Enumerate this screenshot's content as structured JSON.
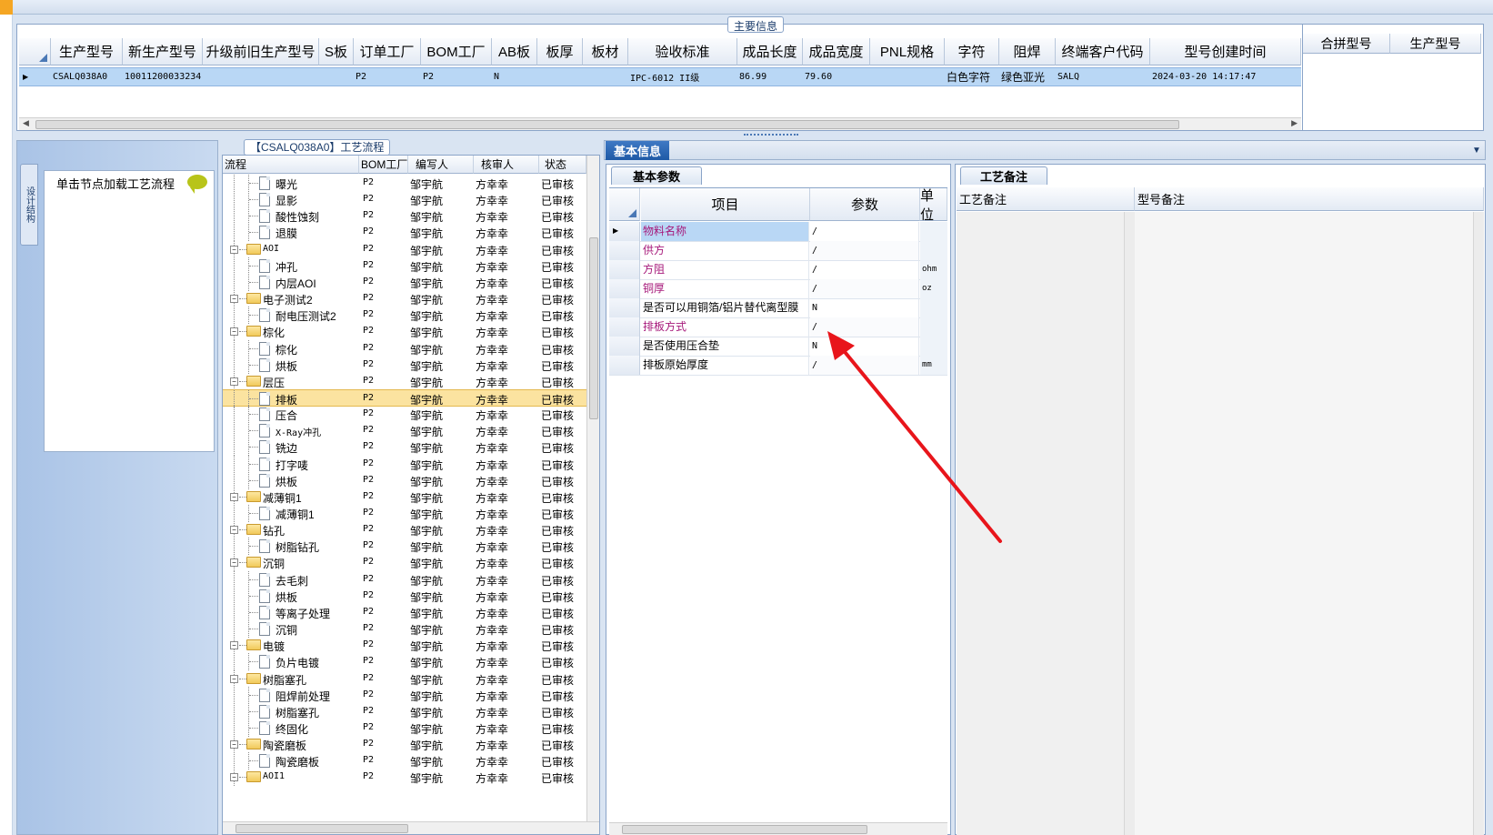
{
  "main_info": {
    "title": "主要信息",
    "columns": [
      "生产型号",
      "新生产型号",
      "升级前旧生产型号",
      "S板",
      "订单工厂",
      "BOM工厂",
      "AB板",
      "板厚",
      "板材",
      "验收标准",
      "成品长度",
      "成品宽度",
      "PNL规格",
      "字符",
      "阻焊",
      "终端客户代码",
      "型号创建时间"
    ],
    "row": {
      "model": "CSALQ038A0",
      "new_model": "10011200033234",
      "old_model": "",
      "s_board": "",
      "order_factory": "P2",
      "bom_factory": "P2",
      "ab_board": "N",
      "thickness": "",
      "material": "",
      "standard": "IPC-6012 II级",
      "length": "86.99",
      "width": "79.60",
      "pnl": "",
      "character": "白色字符",
      "solder_mask": "绿色亚光",
      "customer_code": "SALQ",
      "created": "2024-03-20 14:17:47"
    },
    "merge_columns": [
      "合拼型号",
      "生产型号"
    ]
  },
  "left_nav": {
    "vertical_tab": "设计结构",
    "hint": "单击节点加载工艺流程"
  },
  "process": {
    "title": "【CSALQ038A0】工艺流程",
    "columns": [
      "流程",
      "BOM工厂",
      "编写人",
      "核审人",
      "状态"
    ],
    "rows": [
      {
        "name": "曝光",
        "level": 2,
        "bom": "P2",
        "writer": "邹宇航",
        "reviewer": "方幸幸",
        "status": "已审核"
      },
      {
        "name": "显影",
        "level": 2,
        "bom": "P2",
        "writer": "邹宇航",
        "reviewer": "方幸幸",
        "status": "已审核"
      },
      {
        "name": "酸性蚀刻",
        "level": 2,
        "bom": "P2",
        "writer": "邹宇航",
        "reviewer": "方幸幸",
        "status": "已审核"
      },
      {
        "name": "退膜",
        "level": 2,
        "bom": "P2",
        "writer": "邹宇航",
        "reviewer": "方幸幸",
        "status": "已审核"
      },
      {
        "name": "AOI",
        "level": 1,
        "bom": "P2",
        "writer": "邹宇航",
        "reviewer": "方幸幸",
        "status": "已审核"
      },
      {
        "name": "冲孔",
        "level": 2,
        "bom": "P2",
        "writer": "邹宇航",
        "reviewer": "方幸幸",
        "status": "已审核"
      },
      {
        "name": "内层AOI",
        "level": 2,
        "bom": "P2",
        "writer": "邹宇航",
        "reviewer": "方幸幸",
        "status": "已审核"
      },
      {
        "name": "电子测试2",
        "level": 1,
        "bom": "P2",
        "writer": "邹宇航",
        "reviewer": "方幸幸",
        "status": "已审核"
      },
      {
        "name": "耐电压测试2",
        "level": 2,
        "bom": "P2",
        "writer": "邹宇航",
        "reviewer": "方幸幸",
        "status": "已审核"
      },
      {
        "name": "棕化",
        "level": 1,
        "bom": "P2",
        "writer": "邹宇航",
        "reviewer": "方幸幸",
        "status": "已审核"
      },
      {
        "name": "棕化",
        "level": 2,
        "bom": "P2",
        "writer": "邹宇航",
        "reviewer": "方幸幸",
        "status": "已审核"
      },
      {
        "name": "烘板",
        "level": 2,
        "bom": "P2",
        "writer": "邹宇航",
        "reviewer": "方幸幸",
        "status": "已审核"
      },
      {
        "name": "层压",
        "level": 1,
        "bom": "P2",
        "writer": "邹宇航",
        "reviewer": "方幸幸",
        "status": "已审核"
      },
      {
        "name": "排板",
        "level": 2,
        "bom": "P2",
        "writer": "邹宇航",
        "reviewer": "方幸幸",
        "status": "已审核",
        "selected": true
      },
      {
        "name": "压合",
        "level": 2,
        "bom": "P2",
        "writer": "邹宇航",
        "reviewer": "方幸幸",
        "status": "已审核"
      },
      {
        "name": "X-Ray冲孔",
        "level": 2,
        "bom": "P2",
        "writer": "邹宇航",
        "reviewer": "方幸幸",
        "status": "已审核"
      },
      {
        "name": "铣边",
        "level": 2,
        "bom": "P2",
        "writer": "邹宇航",
        "reviewer": "方幸幸",
        "status": "已审核"
      },
      {
        "name": "打字唛",
        "level": 2,
        "bom": "P2",
        "writer": "邹宇航",
        "reviewer": "方幸幸",
        "status": "已审核"
      },
      {
        "name": "烘板",
        "level": 2,
        "bom": "P2",
        "writer": "邹宇航",
        "reviewer": "方幸幸",
        "status": "已审核"
      },
      {
        "name": "减薄铜1",
        "level": 1,
        "bom": "P2",
        "writer": "邹宇航",
        "reviewer": "方幸幸",
        "status": "已审核"
      },
      {
        "name": "减薄铜1",
        "level": 2,
        "bom": "P2",
        "writer": "邹宇航",
        "reviewer": "方幸幸",
        "status": "已审核"
      },
      {
        "name": "钻孔",
        "level": 1,
        "bom": "P2",
        "writer": "邹宇航",
        "reviewer": "方幸幸",
        "status": "已审核"
      },
      {
        "name": "树脂钻孔",
        "level": 2,
        "bom": "P2",
        "writer": "邹宇航",
        "reviewer": "方幸幸",
        "status": "已审核"
      },
      {
        "name": "沉铜",
        "level": 1,
        "bom": "P2",
        "writer": "邹宇航",
        "reviewer": "方幸幸",
        "status": "已审核"
      },
      {
        "name": "去毛刺",
        "level": 2,
        "bom": "P2",
        "writer": "邹宇航",
        "reviewer": "方幸幸",
        "status": "已审核"
      },
      {
        "name": "烘板",
        "level": 2,
        "bom": "P2",
        "writer": "邹宇航",
        "reviewer": "方幸幸",
        "status": "已审核"
      },
      {
        "name": "等离子处理",
        "level": 2,
        "bom": "P2",
        "writer": "邹宇航",
        "reviewer": "方幸幸",
        "status": "已审核"
      },
      {
        "name": "沉铜",
        "level": 2,
        "bom": "P2",
        "writer": "邹宇航",
        "reviewer": "方幸幸",
        "status": "已审核"
      },
      {
        "name": "电镀",
        "level": 1,
        "bom": "P2",
        "writer": "邹宇航",
        "reviewer": "方幸幸",
        "status": "已审核"
      },
      {
        "name": "负片电镀",
        "level": 2,
        "bom": "P2",
        "writer": "邹宇航",
        "reviewer": "方幸幸",
        "status": "已审核"
      },
      {
        "name": "树脂塞孔",
        "level": 1,
        "bom": "P2",
        "writer": "邹宇航",
        "reviewer": "方幸幸",
        "status": "已审核"
      },
      {
        "name": "阻焊前处理",
        "level": 2,
        "bom": "P2",
        "writer": "邹宇航",
        "reviewer": "方幸幸",
        "status": "已审核"
      },
      {
        "name": "树脂塞孔",
        "level": 2,
        "bom": "P2",
        "writer": "邹宇航",
        "reviewer": "方幸幸",
        "status": "已审核"
      },
      {
        "name": "终固化",
        "level": 2,
        "bom": "P2",
        "writer": "邹宇航",
        "reviewer": "方幸幸",
        "status": "已审核"
      },
      {
        "name": "陶瓷磨板",
        "level": 1,
        "bom": "P2",
        "writer": "邹宇航",
        "reviewer": "方幸幸",
        "status": "已审核"
      },
      {
        "name": "陶瓷磨板",
        "level": 2,
        "bom": "P2",
        "writer": "邹宇航",
        "reviewer": "方幸幸",
        "status": "已审核"
      },
      {
        "name": "AOI1",
        "level": 1,
        "bom": "P2",
        "writer": "邹宇航",
        "reviewer": "方幸幸",
        "status": "已审核"
      }
    ]
  },
  "basic_info": {
    "tab": "基本信息",
    "params_tab": "基本参数",
    "columns": [
      "项目",
      "参数",
      "单位"
    ],
    "rows": [
      {
        "item": "物料名称",
        "value": "/",
        "unit": "",
        "pink": true,
        "current": true
      },
      {
        "item": "供方",
        "value": "/",
        "unit": "",
        "pink": true
      },
      {
        "item": "方阻",
        "value": "/",
        "unit": "ohm",
        "pink": true
      },
      {
        "item": "铜厚",
        "value": "/",
        "unit": "oz",
        "pink": true
      },
      {
        "item": "是否可以用铜箔/铝片替代离型膜",
        "value": "N",
        "unit": "",
        "pink": false
      },
      {
        "item": "排板方式",
        "value": "/",
        "unit": "",
        "pink": true
      },
      {
        "item": "是否使用压合垫",
        "value": "N",
        "unit": "",
        "pink": false
      },
      {
        "item": "排板原始厚度",
        "value": "/",
        "unit": "mm",
        "pink": false
      }
    ]
  },
  "remarks": {
    "tab": "工艺备注",
    "columns": [
      "工艺备注",
      "型号备注"
    ]
  },
  "colors": {
    "accent": "#1f5aa6",
    "selected_row": "#fbe3a0",
    "grid_selected": "#b9d7f5",
    "pink_label": "#a6187a",
    "annotation_arrow": "#e8151b"
  }
}
